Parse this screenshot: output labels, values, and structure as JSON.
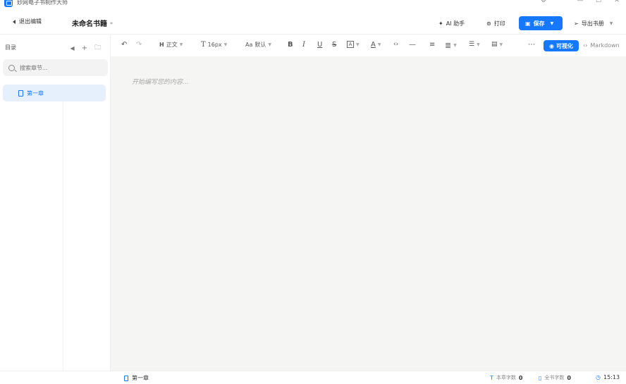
{
  "app": {
    "title": "妙网电子书制作大师",
    "window_controls": [
      "⚙",
      "﹀",
      "—",
      "☐",
      "✕"
    ]
  },
  "header": {
    "back_label": "退出编辑",
    "book_title": "未命名书籍",
    "unsaved_mark": "*",
    "ai_label": "AI 助手",
    "print_label": "打印",
    "save_label": "保存",
    "export_label": "导出书册"
  },
  "sidebar": {
    "heading": "目录",
    "search_placeholder": "搜索章节...",
    "items": [
      {
        "label": "第一章",
        "active": true
      }
    ]
  },
  "toolbar": {
    "heading_label": "正文",
    "heading_icon": "H",
    "font_size": "16px",
    "font_icon": "T",
    "font_family": "默认",
    "font_family_icon": "Aa",
    "visual_label": "可视化",
    "markdown_label": "Markdown"
  },
  "editor": {
    "placeholder": "开始编写您的内容..."
  },
  "statusbar": {
    "chapter": "第一章",
    "chapter_words_label": "本章字数",
    "chapter_words": "0",
    "book_words_label": "全书字数",
    "book_words": "0",
    "time": "15:13"
  },
  "colors": {
    "accent": "#1677ff",
    "editor_bg": "#f5f5f3"
  }
}
